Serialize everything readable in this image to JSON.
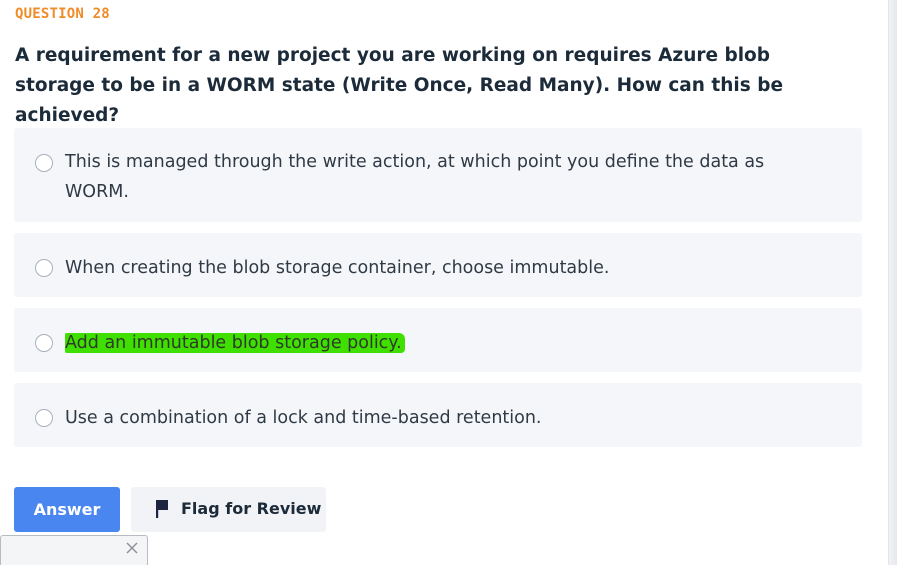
{
  "question": {
    "number_label": "QUESTION 28",
    "text": "A requirement for a new project you are working on requires Azure blob storage to be in a WORM state (Write Once, Read Many). How can this be achieved?"
  },
  "options": [
    {
      "label": "This is managed through the write action, at which point you define the data as WORM.",
      "selected": false
    },
    {
      "label": "When creating the blob storage container, choose immutable.",
      "selected": false
    },
    {
      "label": "Add an immutable blob storage policy.",
      "selected": false,
      "highlighted": true,
      "highlight_color": "#3fe000"
    },
    {
      "label": "Use a combination of a lock and time-based retention.",
      "selected": false
    }
  ],
  "actions": {
    "answer_label": "Answer",
    "flag_label": "Flag for Review",
    "flag_icon": "flag-icon",
    "answer_color": "#4a86f0"
  },
  "popup": {
    "close_icon": "close-icon"
  },
  "colors": {
    "question_number": "#f08c28",
    "question_text": "#1c2b3a",
    "option_bg": "#f5f6fa"
  }
}
